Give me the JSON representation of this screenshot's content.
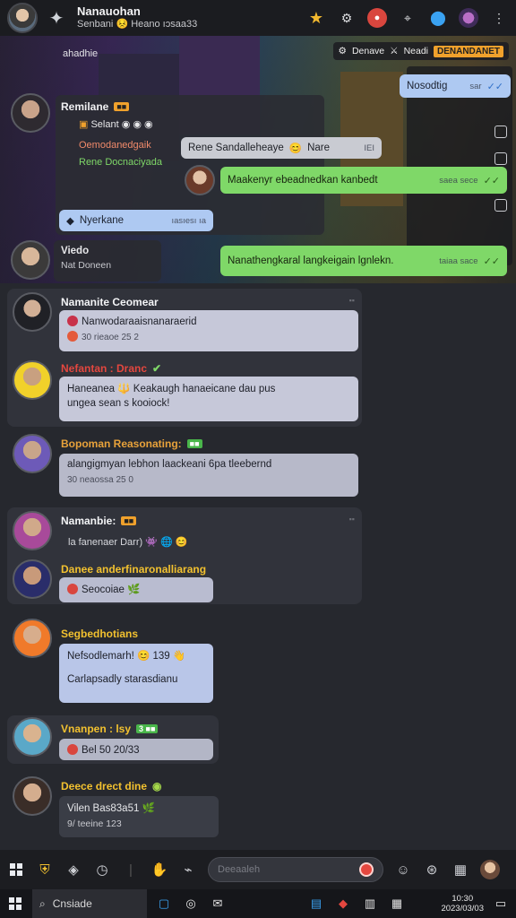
{
  "header": {
    "title": "Nanauohan",
    "subtitle": "Senbani",
    "subtitle_emoji": "😣",
    "subtitle_meta": "Heano ıɔsaa33"
  },
  "scene": {
    "label": "ahadhie",
    "banner_text": "Denave",
    "banner_tag": "Neadi",
    "banner_tag2": "DENANDANET",
    "top_right_bubble": {
      "text": "Nosodtig",
      "meta": "sar"
    },
    "group": {
      "name": "Remilane",
      "line1": "Selant",
      "line2": "Oemodanedgaik",
      "line3": "Rene Docnaciyada"
    },
    "gray_bubble": {
      "text": "Rene Sandalleheaye",
      "emoji": "😊",
      "more": "Nare",
      "meta": "IEI"
    },
    "green_bubble_1": {
      "text": "Maakenyr ebeadnedkan kanbedt",
      "meta": "saea sece"
    },
    "blue_bubble_small": {
      "text": "Nyerkane",
      "meta": "ıasıesı ıa"
    },
    "lower_name": "Viedo",
    "lower_sub": "Nat Doneen",
    "green_bubble_2": {
      "text": "Nanathengkaral langkeigain lgnlekn.",
      "meta": "taiaa sace"
    }
  },
  "chats": [
    {
      "name": "Namanite Ceomear",
      "name_color": "#f3f4f6",
      "badge": "",
      "time": "",
      "messages": [
        {
          "text": "Nanwodaraaisnanaraerid",
          "sub": "30 rieaoe 25 2"
        }
      ]
    },
    {
      "name": "Nefantan : Dranc",
      "name_color": "#e4473f",
      "badge": "",
      "time": "",
      "messages": [
        {
          "text": "Haneanea 🔱 Keakaugh hanaeicane dau pus",
          "sub": "ungea sean s kooiock!"
        }
      ]
    },
    {
      "name": "Bopoman Reasonating:",
      "name_color": "#e8a23a",
      "name_accent": "Reasonating:",
      "badge": "■■",
      "time": "",
      "messages": [
        {
          "text": "alangigmyan lebhon laackeani 6pa tleebernd",
          "sub": "30 neaossa 25 0"
        }
      ]
    },
    {
      "name": "Namanbie:",
      "name_color": "#f3f4f6",
      "badge": "■■",
      "time": "",
      "messages": [
        {
          "text": "la fanenaer Darr) 👾 🌐 😊"
        },
        {
          "name": "Danee anderfinaronalliarang",
          "name_color": "#f2c12f",
          "text": "Seocoiae 🌿"
        }
      ]
    },
    {
      "name": "Segbedhotians",
      "name_color": "#f2c12f",
      "badge": "",
      "time": "",
      "messages": [
        {
          "text": "Nefsodlemarh! 😊 139 👋",
          "sub": "Carlapsadly starasdianu"
        }
      ]
    },
    {
      "name": "Vnanpen : lsy",
      "name_color": "#f2c12f",
      "badge": "3 ■■",
      "time": "",
      "messages": [
        {
          "text": "Bel 50 20/33"
        }
      ]
    },
    {
      "name": "Deece drect dine",
      "name_color": "#f2c12f",
      "badge": "",
      "time": "",
      "messages": [
        {
          "text": "Vilen Bas83a51 🌿",
          "sub": "9/ teeine 123"
        }
      ]
    }
  ],
  "input": {
    "placeholder": "Deeaaleh"
  },
  "taskbar": {
    "search_label": "Cnsiade",
    "clock_time": "10:30",
    "clock_date": "2023/03/03"
  }
}
